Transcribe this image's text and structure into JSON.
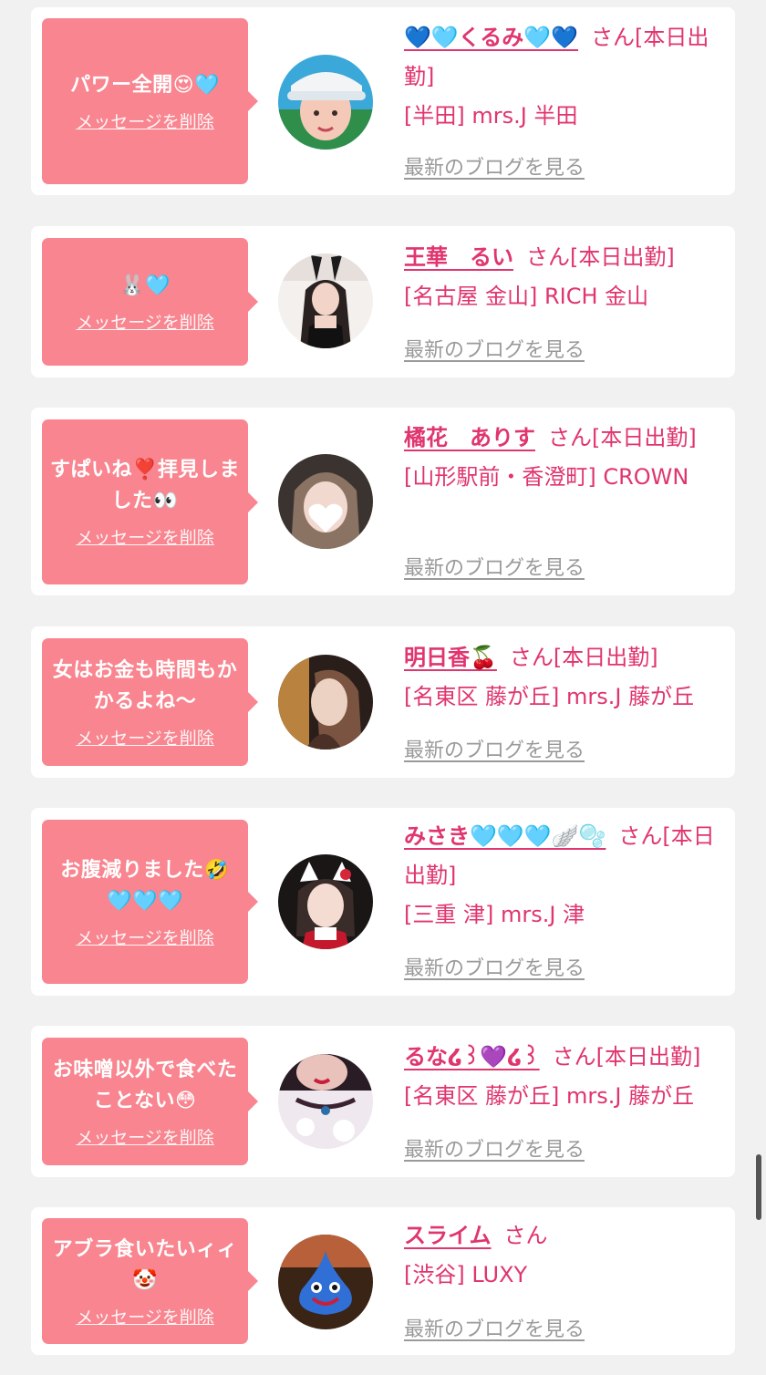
{
  "delete_label": "メッセージを削除",
  "blog_label": "最新のブログを見る",
  "accent_color": "#e0356d",
  "bubble_color": "#f8858f",
  "cards": [
    {
      "message": "パワー全開😍🩵",
      "name": "💙🩵くるみ🩵💙",
      "status_line": "さん[本日出勤]",
      "location": "[半田] mrs.J 半田",
      "avatar": "woman-visor-avatar"
    },
    {
      "message": "🐰🩵",
      "name": "王華　るい",
      "status_line": "さん[本日出勤]",
      "location": "[名古屋 金山] RICH 金山",
      "avatar": "bunny-costume-avatar"
    },
    {
      "message": "すぱいね❣️拝見しました👀",
      "name": "橘花　ありす",
      "status_line": "さん[本日出勤]",
      "location": "[山形駅前・香澄町] CROWN",
      "avatar": "heart-face-avatar"
    },
    {
      "message": "女はお金も時間もかかるよね〜",
      "name": "明日香🍒",
      "status_line": "さん[本日出勤]",
      "location": "[名東区 藤が丘] mrs.J 藤が丘",
      "avatar": "long-hair-avatar"
    },
    {
      "message": "お腹減りました🤣🩵🩵🩵",
      "name": "みさき🩵🩵🩵🪽🫧",
      "status_line": "さん[本日出勤]",
      "location": "[三重 津] mrs.J 津",
      "avatar": "cat-ears-avatar"
    },
    {
      "message": "お味噌以外で食べたことない😳",
      "name": "るな໒꒱💜໒꒱",
      "status_line": "さん[本日出勤]",
      "location": "[名東区 藤が丘] mrs.J 藤が丘",
      "avatar": "lace-choker-avatar"
    },
    {
      "message": "アブラ食いたいィィ🤡",
      "name": "スライム",
      "status_line": "さん",
      "location": "[渋谷] LUXY",
      "avatar": "slime-avatar"
    }
  ]
}
